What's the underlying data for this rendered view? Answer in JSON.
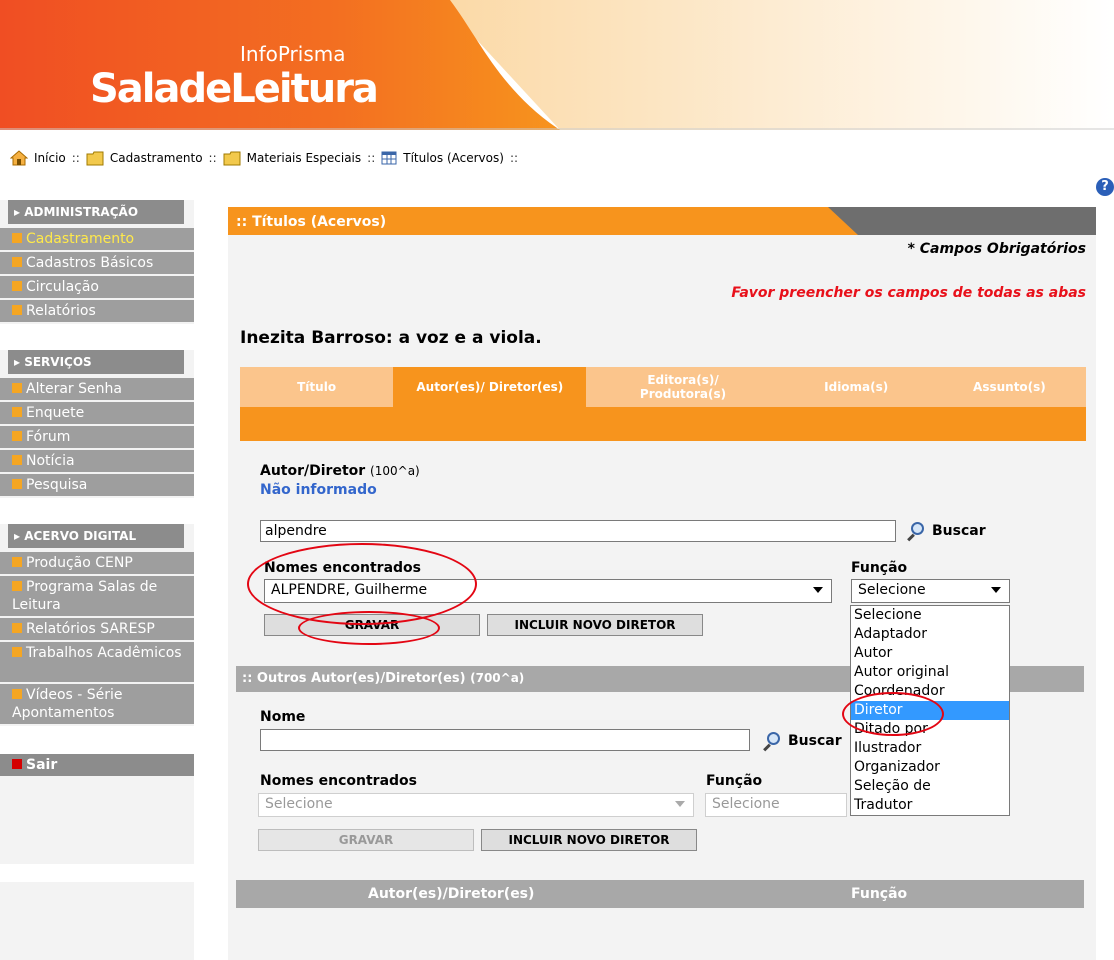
{
  "brand": {
    "top": "InfoPrisma",
    "main": "SaladeLeitura"
  },
  "breadcrumb": {
    "items": [
      "Início",
      "Cadastramento",
      "Materiais Especiais",
      "Títulos (Acervos)"
    ],
    "sep": "::"
  },
  "sidebar": {
    "groups": [
      {
        "title": "ADMINISTRAÇÃO",
        "items": [
          "Cadastramento",
          "Cadastros Básicos",
          "Circulação",
          "Relatórios"
        ]
      },
      {
        "title": "SERVIÇOS",
        "items": [
          "Alterar Senha",
          "Enquete",
          "Fórum",
          "Notícia",
          "Pesquisa"
        ]
      },
      {
        "title": "ACERVO DIGITAL",
        "items": [
          "Produção CENP",
          "Programa Salas de Leitura",
          "Relatórios SARESP",
          "Trabalhos Acadêmicos",
          "Vídeos - Série Apontamentos"
        ]
      }
    ],
    "sair": "Sair"
  },
  "help": "?",
  "panel": {
    "title": ":: Títulos (Acervos)",
    "required_note": "* Campos Obrigatórios",
    "warning": "Favor preencher os campos de todas as abas",
    "book_title": "Inezita Barroso: a voz e a viola."
  },
  "tabs": [
    {
      "label": "Título",
      "active": false
    },
    {
      "label": "Autor(es)/ Diretor(es)",
      "active": true
    },
    {
      "label": "Editora(s)/ Produtora(s)",
      "active": false
    },
    {
      "label": "Idioma(s)",
      "active": false
    },
    {
      "label": "Assunto(s)",
      "active": false
    }
  ],
  "autor": {
    "label": "Autor/Diretor",
    "code": "(100^a)",
    "status": "Não informado",
    "search_value": "alpendre",
    "buscar": "Buscar",
    "found_label": "Nomes encontrados",
    "found_value": "ALPENDRE, Guilherme",
    "funcao_label": "Função",
    "funcao_value": "Selecione",
    "gravar": "GRAVAR",
    "incluir": "INCLUIR NOVO DIRETOR"
  },
  "funcao_options": [
    "Selecione",
    "Adaptador",
    "Autor",
    "Autor original",
    "Coordenador",
    "Diretor",
    "Ditado por",
    "Ilustrador",
    "Organizador",
    "Seleção de",
    "Tradutor"
  ],
  "funcao_selected": "Diretor",
  "outros": {
    "title": ":: Outros Autor(es)/Diretor(es)",
    "code": "(700^a)",
    "nome_label": "Nome",
    "nome_value": "",
    "buscar": "Buscar",
    "found_label": "Nomes encontrados",
    "found_value": "Selecione",
    "funcao_label": "Função",
    "funcao_value": "Selecione",
    "gravar": "GRAVAR",
    "incluir": "INCLUIR NOVO DIRETOR"
  },
  "table": {
    "col1": "Autor(es)/Diretor(es)",
    "col2": "Função"
  },
  "colors": {
    "orange": "#f7941d",
    "light_orange": "#fbc58c",
    "gray": "#a8a8a8",
    "warning_red": "#e8101a",
    "link_blue": "#3366cc"
  }
}
